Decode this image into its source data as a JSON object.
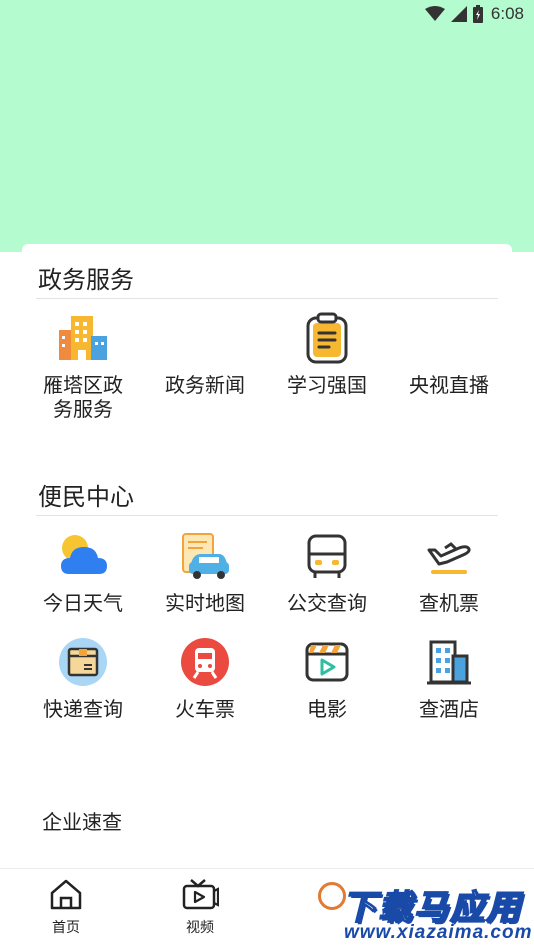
{
  "status_bar": {
    "time": "6:08"
  },
  "sections": {
    "gov": {
      "title": "政务服务",
      "items": [
        {
          "label": "雁塔区政务服务",
          "icon": "building-icon"
        },
        {
          "label": "政务新闻",
          "icon": "news-icon"
        },
        {
          "label": "学习强国",
          "icon": "clipboard-icon"
        },
        {
          "label": "央视直播",
          "icon": "tv-icon"
        }
      ]
    },
    "convenience": {
      "title": "便民中心",
      "items": [
        {
          "label": "今日天气",
          "icon": "weather-icon"
        },
        {
          "label": "实时地图",
          "icon": "map-car-icon"
        },
        {
          "label": "公交查询",
          "icon": "bus-icon"
        },
        {
          "label": "查机票",
          "icon": "airplane-icon"
        },
        {
          "label": "快递查询",
          "icon": "package-icon"
        },
        {
          "label": "火车票",
          "icon": "train-icon"
        },
        {
          "label": "电影",
          "icon": "movie-icon"
        },
        {
          "label": "查酒店",
          "icon": "hotel-icon"
        }
      ]
    }
  },
  "enterprise": {
    "label": "企业速查"
  },
  "tabbar": {
    "home": "首页",
    "video": "视频"
  },
  "watermark": {
    "title": "下载马应用",
    "url": "www.xiazaima.com"
  },
  "colors": {
    "banner": "#b5fbd0",
    "accent_orange": "#f2a33a",
    "blue": "#2f7ff0"
  }
}
